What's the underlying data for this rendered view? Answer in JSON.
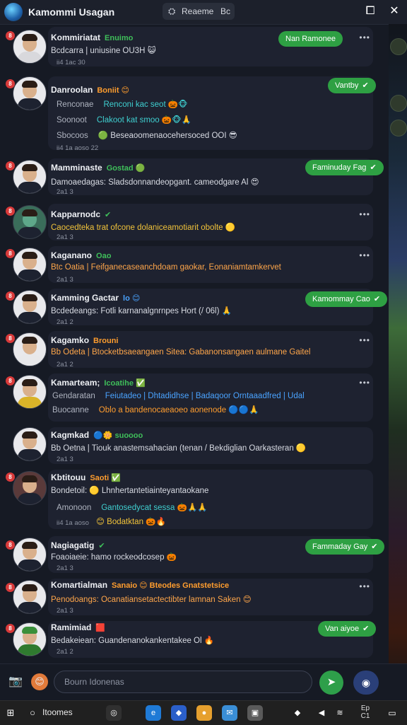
{
  "window": {
    "title": "Kamommi Usagan",
    "search_text": "Reaeme",
    "search_suffix": "Bc",
    "maximize_icon": "square-icon",
    "close_icon": "close-icon"
  },
  "messages": [
    {
      "name": "Kommiriatat",
      "tag": "Enuimo",
      "tag_color": "g",
      "line": "Bcdcarra | uniusine OU3H 😺",
      "sub_lines": [],
      "meta": "ii4 1ac 30",
      "pill": "Nan Ramonee",
      "badge": "8"
    },
    {
      "name": "Danroolan",
      "tag": "Boniit 😊",
      "tag_color": "o",
      "line": "",
      "sub_lines": [
        {
          "label": "Renconae",
          "value": "Renconi kac seot 🎃🐵"
        },
        {
          "label": "Soonoot",
          "value": "Clakoot kat smoo 🎃🐵🙏"
        },
        {
          "label": "Sbocoos",
          "value": "🟢 Beseaoomenaocehersoced OOI 😎"
        }
      ],
      "meta": "ii4 1a aoso 22",
      "pill": "Vantby",
      "badge": "8"
    },
    {
      "name": "Mamminaste",
      "tag": "Gostad 🟢",
      "tag_color": "g",
      "line": "Damoaedagas: Sladsdonnandeopgant. cameodgare Al 😍",
      "sub_lines": [],
      "meta": "2a1 3",
      "pill": "Faminuday Fag",
      "badge": "8"
    },
    {
      "name": "Kapparnodc",
      "tag": "✔",
      "tag_color": "g",
      "line": "Caocedteka trat ofcone dolaniceamotiarit obolte 🟡",
      "sub_lines": [],
      "meta": "2a1 3",
      "pill": "",
      "badge": "8"
    },
    {
      "name": "Kaganano",
      "tag": "Oao",
      "tag_color": "g",
      "line": "Btc Oatia | Feifganecaseanchdoam gaokar, Eonaniamtamkervet",
      "sub_lines": [],
      "meta": "2a1 3",
      "pill": "",
      "badge": "8"
    },
    {
      "name": "Kamming Gactar",
      "tag": "lo 😊",
      "tag_color": "b",
      "line": "Bcdedeangs: Fotli karnanalgnrnpes Hort (/ 06l) 🙏",
      "sub_lines": [],
      "meta": "2a1 2",
      "pill": "Kamommay Cao",
      "badge": "8"
    },
    {
      "name": "Kagamko",
      "tag": "Brouni",
      "tag_color": "o",
      "line": "Bb Odeta | Btocketbsaeangaen Sitea: Gabanonsangaen aulmane Gaitel",
      "sub_lines": [],
      "meta": "2a1 2",
      "pill": "",
      "badge": "8"
    },
    {
      "name": "Kamarteam;",
      "tag": "Icoatihe ✅",
      "tag_color": "g",
      "line": "",
      "sub_lines": [
        {
          "label": "Gendaratan",
          "value": "Feiutadeo | Dhtadidhse | Badaqoor Orntaaadfred | Udal"
        },
        {
          "label": "Buocanne",
          "value": "Oblo a bandenocaeaoeo aonenode 🔵🔵🙏"
        }
      ],
      "meta": "",
      "pill": "",
      "badge": "8"
    },
    {
      "name": "Kagmkad",
      "tag": "🔵🌼 suoooo",
      "tag_color": "g",
      "line": "Bb Oetna | Tiouk anastemsahacian (tenan / Bekdiglian Oarkasteran 🟡",
      "sub_lines": [],
      "meta": "2a1 3",
      "pill": "",
      "badge": ""
    },
    {
      "name": "Kbtitouu",
      "tag": "Saoti ✅",
      "tag_color": "o",
      "line": "Bondetoil: 🟡 Lhnhertantetiainteyantaokane",
      "sub_lines": [
        {
          "label": "Amonoon",
          "value": "Gantosedycat sessa 🎃🙏🙏"
        },
        {
          "label": "",
          "value": "😊 Bodatktan 🎃🔥"
        }
      ],
      "meta": "ii4 1a aoso",
      "pill": "",
      "badge": "8"
    },
    {
      "name": "Nagiagatig",
      "tag": "✔",
      "tag_color": "g",
      "line": "Foaoiaeie: hamo rockeodcosep 🎃",
      "sub_lines": [],
      "meta": "2a1 3",
      "pill": "Fammaday Gay",
      "badge": "8"
    },
    {
      "name": "Komartialman",
      "tag": "Sanaio 😊 Bteodes Gnatstetsice",
      "tag_color": "o",
      "line": "Penodoangs: Ocanatiansetactectibter lamnan Saken 😊",
      "sub_lines": [],
      "meta": "2a1 3",
      "pill": "",
      "badge": "8"
    },
    {
      "name": "Ramimiad",
      "tag": "🟥",
      "tag_color": "o",
      "line": "Bedakeiean: Guandenanokankentakee Ol 🔥",
      "sub_lines": [],
      "meta": "2a1 2",
      "pill": "Van aiyoe",
      "badge": "8"
    }
  ],
  "composer": {
    "placeholder": "Bourn Idonenas",
    "camera_icon": "camera-icon",
    "emoji_icon": "emoji-icon",
    "send_icon": "send-icon",
    "voice_icon": "voice-icon"
  },
  "taskbar": {
    "start_label": "Itoomes",
    "clock_line1": "Ep",
    "clock_line2": "C1"
  }
}
